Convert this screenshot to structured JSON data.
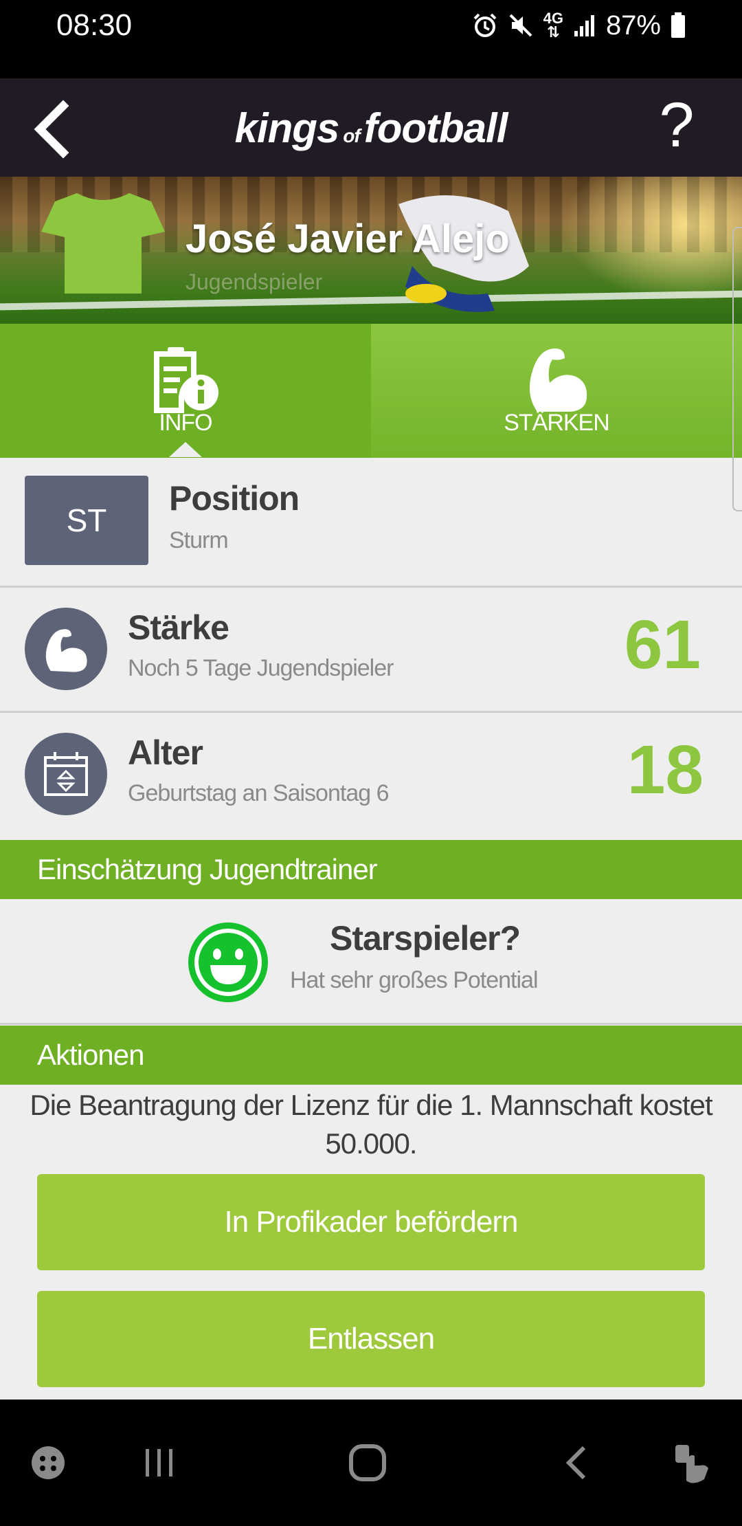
{
  "status_bar": {
    "time": "08:30",
    "network": "4G",
    "battery": "87%",
    "icons": [
      "alarm-icon",
      "mute-icon",
      "network-4g-icon",
      "signal-icon",
      "battery-icon"
    ]
  },
  "header": {
    "logo_main_1": "kings",
    "logo_of": "of",
    "logo_main_2": "football",
    "help_label": "?",
    "icons": [
      "back-arrow-icon",
      "help-icon"
    ]
  },
  "player": {
    "name": "José Javier Alejo",
    "role": "Jugendspieler",
    "jersey_color": "#8dc63f"
  },
  "tabs": [
    {
      "label": "INFO",
      "icon": "info-document-icon",
      "active": true
    },
    {
      "label": "STÄRKEN",
      "icon": "bicep-icon",
      "active": false
    }
  ],
  "position": {
    "badge": "ST",
    "title": "Position",
    "value": "Sturm"
  },
  "strength": {
    "title": "Stärke",
    "subtitle": "Noch 5 Tage Jugendspieler",
    "value": "61"
  },
  "age": {
    "title": "Alter",
    "subtitle": "Geburtstag an Saisontag 6",
    "value": "18"
  },
  "coach_assessment": {
    "header": "Einschätzung Jugendtrainer",
    "title": "Starspieler?",
    "subtitle": "Hat sehr großes Potential",
    "icon": "smiley-icon",
    "icon_color": "#15c12d"
  },
  "actions": {
    "header": "Aktionen",
    "license_text": "Die Beantragung der Lizenz für die 1. Mannschaft kostet 50.000.",
    "promote_label": "In Profikader befördern",
    "dismiss_label": "Entlassen"
  },
  "colors": {
    "accent_green": "#8dc63f",
    "header_bg": "#211b26",
    "badge_bg": "#5d6478",
    "button_green": "#9ec93c"
  },
  "nav_bar": {
    "icons": [
      "game-launcher-icon",
      "recent-apps-icon",
      "home-icon",
      "back-icon",
      "touch-icon"
    ]
  }
}
